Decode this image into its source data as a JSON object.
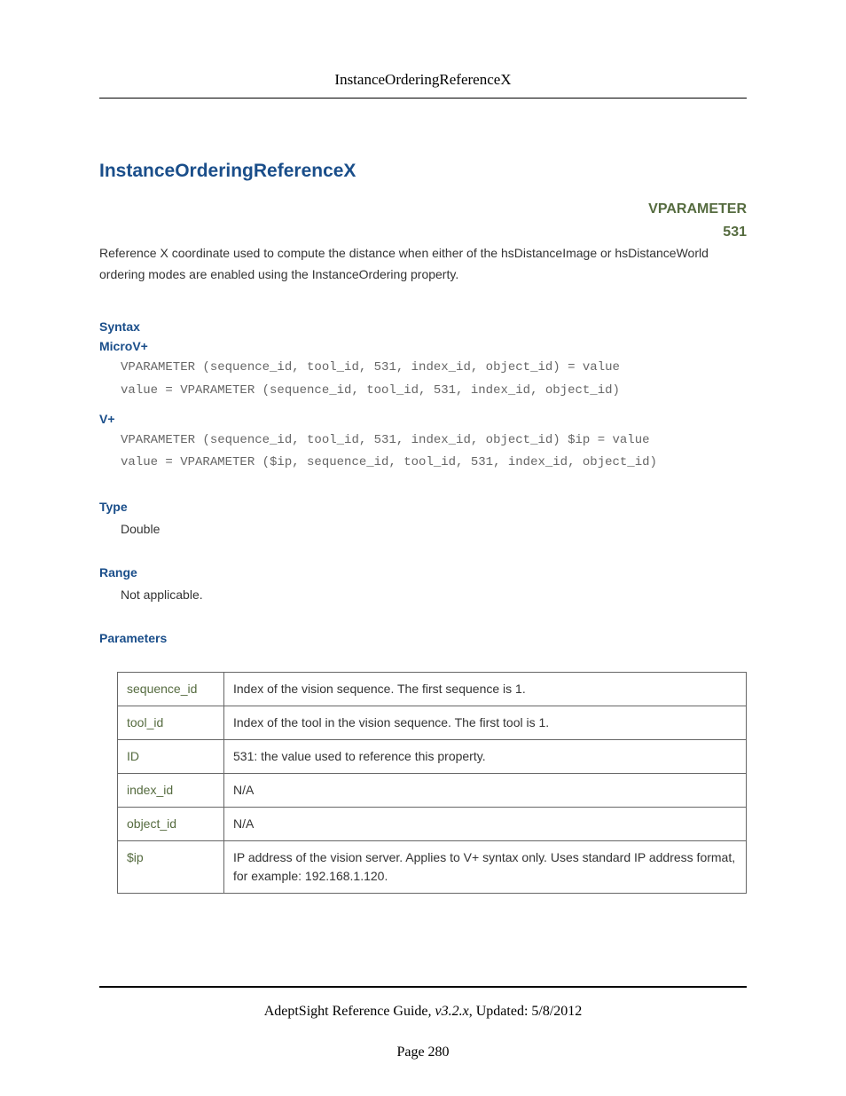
{
  "header": {
    "title": "InstanceOrderingReferenceX"
  },
  "main": {
    "title": "InstanceOrderingReferenceX",
    "vparameter_label": "VPARAMETER",
    "vparameter_number": "531",
    "description": "Reference X coordinate used to compute the distance when either of the hsDistanceImage or hsDistanceWorld ordering modes are enabled using the InstanceOrdering property."
  },
  "syntax": {
    "heading": "Syntax",
    "microv_heading": "MicroV+",
    "microv_code": "VPARAMETER (sequence_id, tool_id, 531, index_id, object_id) = value\nvalue = VPARAMETER (sequence_id, tool_id, 531, index_id, object_id)",
    "vplus_heading": "V+",
    "vplus_code": "VPARAMETER (sequence_id, tool_id, 531, index_id, object_id) $ip = value\nvalue = VPARAMETER ($ip, sequence_id, tool_id, 531, index_id, object_id)"
  },
  "type": {
    "heading": "Type",
    "value": "Double"
  },
  "range": {
    "heading": "Range",
    "value": "Not applicable."
  },
  "parameters": {
    "heading": "Parameters",
    "rows": [
      {
        "name": "sequence_id",
        "desc": "Index of the vision sequence. The first sequence is 1."
      },
      {
        "name": "tool_id",
        "desc": "Index of the tool in the vision sequence. The first tool is 1."
      },
      {
        "name": "ID",
        "desc": "531: the value used to reference this property."
      },
      {
        "name": "index_id",
        "desc": "N/A"
      },
      {
        "name": "object_id",
        "desc": "N/A"
      },
      {
        "name": "$ip",
        "desc": "IP address of the vision server. Applies to V+ syntax only. Uses standard IP address format, for example: 192.168.1.120."
      }
    ]
  },
  "footer": {
    "guide": "AdeptSight Reference Guide",
    "version": ", v3.2.x",
    "updated": ", Updated: 5/8/2012",
    "page": "Page 280"
  }
}
